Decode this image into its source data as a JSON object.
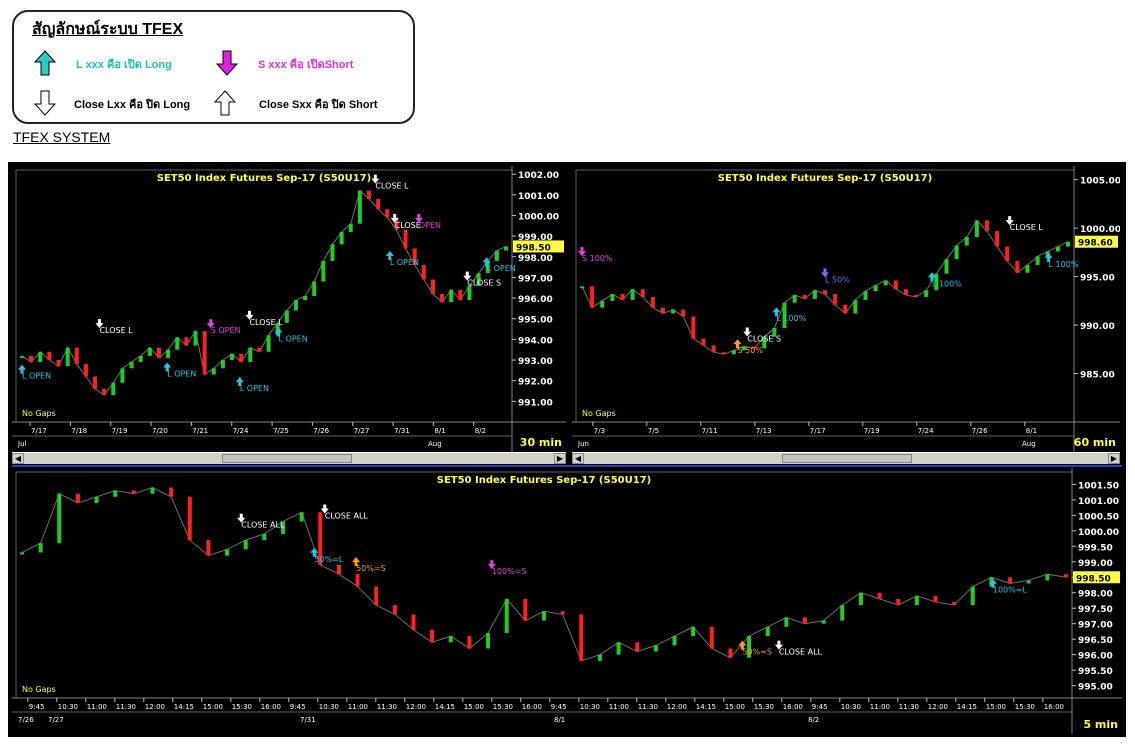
{
  "legend": {
    "title": "สัญลักษณ์ระบบ TFEX",
    "items": [
      {
        "text": "L xxx คือ เปิด Long",
        "color": "#20c0c0"
      },
      {
        "text": "S xxx คือ เปิดShort",
        "color": "#e030e0"
      },
      {
        "text": "Close Lxx คือ ปิด Long",
        "color": "#000000"
      },
      {
        "text": "Close Sxx คือ ปิด Short",
        "color": "#000000"
      }
    ]
  },
  "system_title": "TFEX SYSTEM",
  "colors": {
    "up": "#22cc22",
    "down": "#ff2020",
    "title": "#ffff40",
    "long": "#20c8e0",
    "short": "#e040e0",
    "close": "#ffffff",
    "half": "#ff9a20",
    "lavender": "#7070ff"
  },
  "chart_data": [
    {
      "type": "line",
      "title": "SET50 Index Futures Sep-17 (S50U17)",
      "timeframe": "30 min",
      "note": "No Gaps",
      "price_label": "998.50",
      "yticks": [
        "1002.00",
        "1001.00",
        "1000.00",
        "999.00",
        "998.00",
        "997.00",
        "996.00",
        "995.00",
        "994.00",
        "993.00",
        "992.00",
        "991.00"
      ],
      "ylim": [
        990,
        1002.2
      ],
      "xticks": [
        "7/17",
        "7/18",
        "7/19",
        "7/20",
        "7/21",
        "7/24",
        "7/25",
        "7/26",
        "7/27",
        "7/31",
        "8/1",
        "8/2"
      ],
      "month_labels": [
        "Jul",
        "Aug"
      ],
      "y": [
        993.2,
        992.9,
        993.4,
        993.0,
        992.7,
        993.6,
        992.8,
        992.2,
        991.6,
        991.3,
        991.9,
        992.6,
        992.9,
        993.2,
        993.6,
        993.1,
        993.5,
        994.1,
        993.7,
        994.4,
        992.3,
        992.6,
        993.0,
        993.3,
        992.9,
        993.6,
        993.4,
        994.2,
        994.8,
        995.4,
        995.9,
        996.1,
        996.8,
        997.8,
        998.6,
        999.2,
        999.6,
        1001.2,
        1000.8,
        1000.3,
        999.9,
        999.3,
        998.4,
        997.6,
        996.9,
        996.2,
        995.8,
        996.4,
        995.9,
        996.6,
        997.2,
        997.8,
        998.3,
        998.5
      ],
      "annotations": [
        {
          "text": "L OPEN",
          "x": 0.0,
          "y": 992.1,
          "kind": "long"
        },
        {
          "text": "CLOSE L",
          "x": 0.16,
          "y": 994.3,
          "kind": "close"
        },
        {
          "text": "L OPEN",
          "x": 0.3,
          "y": 992.2,
          "kind": "long"
        },
        {
          "text": "S OPEN",
          "x": 0.39,
          "y": 994.3,
          "kind": "short"
        },
        {
          "text": "L OPEN",
          "x": 0.45,
          "y": 991.5,
          "kind": "long"
        },
        {
          "text": "CLOSE L",
          "x": 0.47,
          "y": 994.7,
          "kind": "close"
        },
        {
          "text": "L OPEN",
          "x": 0.53,
          "y": 993.9,
          "kind": "long"
        },
        {
          "text": "CLOSE L",
          "x": 0.73,
          "y": 1001.3,
          "kind": "close"
        },
        {
          "text": "CLOSE",
          "x": 0.77,
          "y": 999.4,
          "kind": "close"
        },
        {
          "text": "OPEN",
          "x": 0.82,
          "y": 999.4,
          "kind": "short"
        },
        {
          "text": "L OPEN",
          "x": 0.76,
          "y": 997.6,
          "kind": "long"
        },
        {
          "text": "CLOSE S",
          "x": 0.92,
          "y": 996.6,
          "kind": "close"
        },
        {
          "text": "L OPEN",
          "x": 0.96,
          "y": 997.3,
          "kind": "long"
        }
      ]
    },
    {
      "type": "line",
      "title": "SET50 Index Futures Sep-17 (S50U17)",
      "timeframe": "60 min",
      "note": "No Gaps",
      "price_label": "998.60",
      "yticks": [
        "1005.00",
        "1000.00",
        "995.00",
        "990.00",
        "985.00"
      ],
      "ylim": [
        980,
        1006
      ],
      "xticks": [
        "7/3",
        "7/5",
        "7/11",
        "7/13",
        "7/17",
        "7/19",
        "7/24",
        "7/26",
        "8/1"
      ],
      "month_labels": [
        "Jun",
        "Aug"
      ],
      "y": [
        994.0,
        991.8,
        992.5,
        993.2,
        992.6,
        993.7,
        992.9,
        991.8,
        991.2,
        991.6,
        990.9,
        988.6,
        987.9,
        987.2,
        987.0,
        987.4,
        987.8,
        987.6,
        988.8,
        989.7,
        992.3,
        993.1,
        992.7,
        993.6,
        993.2,
        992.1,
        991.2,
        992.6,
        993.5,
        994.1,
        994.6,
        993.7,
        993.1,
        992.9,
        993.6,
        995.3,
        996.8,
        998.2,
        999.1,
        1000.8,
        999.7,
        998.1,
        996.6,
        995.4,
        996.2,
        997.1,
        997.6,
        998.1,
        998.6
      ],
      "annotations": [
        {
          "text": "S 100%",
          "x": 0.0,
          "y": 996.6,
          "kind": "short"
        },
        {
          "text": "CLOSE S",
          "x": 0.34,
          "y": 988.3,
          "kind": "close"
        },
        {
          "text": "S 50%",
          "x": 0.32,
          "y": 987.1,
          "kind": "half"
        },
        {
          "text": "L 100%",
          "x": 0.4,
          "y": 990.4,
          "kind": "long"
        },
        {
          "text": "L 50%",
          "x": 0.5,
          "y": 994.4,
          "kind": "lavender"
        },
        {
          "text": "L 100%",
          "x": 0.72,
          "y": 994.0,
          "kind": "long"
        },
        {
          "text": "CLOSE L",
          "x": 0.88,
          "y": 999.8,
          "kind": "close"
        },
        {
          "text": "L 100%",
          "x": 0.96,
          "y": 996.0,
          "kind": "long"
        }
      ]
    },
    {
      "type": "line",
      "title": "SET50 Index Futures Sep-17 (S50U17)",
      "timeframe": "5 min",
      "note": "No Gaps",
      "price_label": "998.50",
      "yticks": [
        "1001.50",
        "1001.00",
        "1000.50",
        "1000.00",
        "999.50",
        "999.00",
        "998.50",
        "998.00",
        "997.50",
        "997.00",
        "996.50",
        "996.00",
        "995.50",
        "995.00"
      ],
      "ylim": [
        994.6,
        1001.9
      ],
      "xticks": [
        "9:45",
        "10:30",
        "11:00",
        "11:30",
        "12:00",
        "14:15",
        "15:00",
        "15:30",
        "16:00",
        "9:45",
        "10:30",
        "11:00",
        "11:30",
        "12:00",
        "14:15",
        "15:00",
        "15:30",
        "16:00",
        "9:45",
        "10:30",
        "11:00",
        "11:30",
        "12:00",
        "14:15",
        "15:00",
        "15:30",
        "16:00",
        "9:45",
        "10:30",
        "11:00",
        "11:30",
        "12:00",
        "14:15",
        "15:00",
        "15:30",
        "16:00"
      ],
      "date_labels": [
        "7/26",
        "7/27",
        "7/31",
        "8/1",
        "8/2"
      ],
      "y": [
        999.3,
        999.6,
        1001.2,
        1000.9,
        1001.1,
        1001.3,
        1001.2,
        1001.4,
        1001.1,
        999.7,
        999.2,
        999.4,
        999.7,
        999.9,
        1000.3,
        1000.6,
        998.9,
        998.6,
        998.2,
        997.6,
        997.3,
        996.8,
        996.4,
        996.6,
        996.2,
        996.7,
        997.8,
        997.1,
        997.4,
        997.3,
        995.8,
        996.0,
        996.4,
        996.1,
        996.3,
        996.6,
        996.9,
        996.2,
        995.9,
        996.6,
        996.9,
        997.2,
        997.0,
        997.1,
        997.6,
        998.0,
        997.8,
        997.6,
        997.9,
        997.7,
        997.6,
        998.2,
        998.5,
        998.3,
        998.4,
        998.6,
        998.5
      ],
      "annotations": [
        {
          "text": "CLOSE ALL",
          "x": 0.21,
          "y": 1000.1,
          "kind": "close"
        },
        {
          "text": "CLOSE ALL",
          "x": 0.29,
          "y": 1000.4,
          "kind": "close"
        },
        {
          "text": "50%=L",
          "x": 0.28,
          "y": 999.0,
          "kind": "long"
        },
        {
          "text": "50%=S",
          "x": 0.32,
          "y": 998.7,
          "kind": "half"
        },
        {
          "text": "100%=S",
          "x": 0.45,
          "y": 998.6,
          "kind": "short"
        },
        {
          "text": "50%=S",
          "x": 0.69,
          "y": 996.0,
          "kind": "half"
        },
        {
          "text": "CLOSE ALL",
          "x": 0.725,
          "y": 996.0,
          "kind": "close"
        },
        {
          "text": "100%=L",
          "x": 0.93,
          "y": 998.0,
          "kind": "long"
        }
      ]
    }
  ]
}
